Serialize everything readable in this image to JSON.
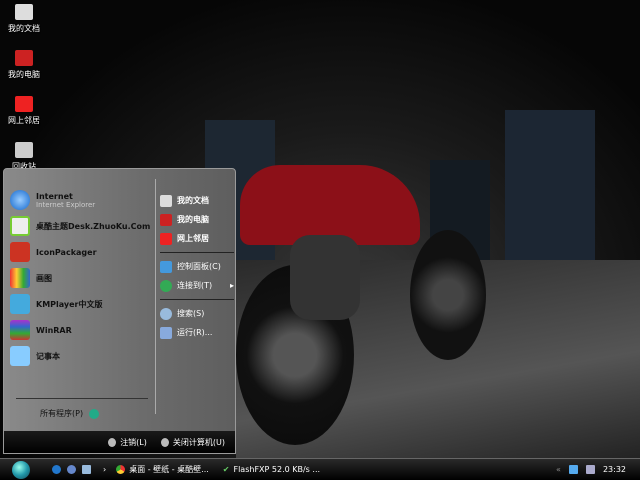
{
  "desktop_icons": [
    {
      "label": "我的文档"
    },
    {
      "label": "我的电脑"
    },
    {
      "label": "网上邻居"
    },
    {
      "label": "回收站"
    }
  ],
  "start_menu": {
    "pinned": [
      {
        "title": "Internet",
        "subtitle": "Internet Explorer",
        "icon": "ie-icon"
      }
    ],
    "programs": [
      {
        "title": "桌酷主题Desk.ZhuoKu.Com"
      },
      {
        "title": "IconPackager"
      },
      {
        "title": "画图"
      },
      {
        "title": "KMPlayer中文版"
      },
      {
        "title": "WinRAR"
      },
      {
        "title": "记事本"
      }
    ],
    "all_programs": "所有程序(P)",
    "right": [
      {
        "label": "我的文档",
        "bold": true
      },
      {
        "label": "我的电脑",
        "bold": true
      },
      {
        "label": "网上邻居",
        "bold": true
      },
      {
        "label": "控制面板(C)"
      },
      {
        "label": "连接到(T)"
      },
      {
        "label": "搜索(S)"
      },
      {
        "label": "运行(R)..."
      }
    ],
    "logoff": "注销(L)",
    "shutdown": "关闭计算机(U)"
  },
  "taskbar": {
    "tasks": [
      {
        "label": "桌面 - 壁纸 - 桌酷壁..."
      },
      {
        "label": "FlashFXP 52.0 KB/s ..."
      }
    ],
    "clock": "23:32"
  },
  "colors": {
    "accent": "#c0141c"
  }
}
